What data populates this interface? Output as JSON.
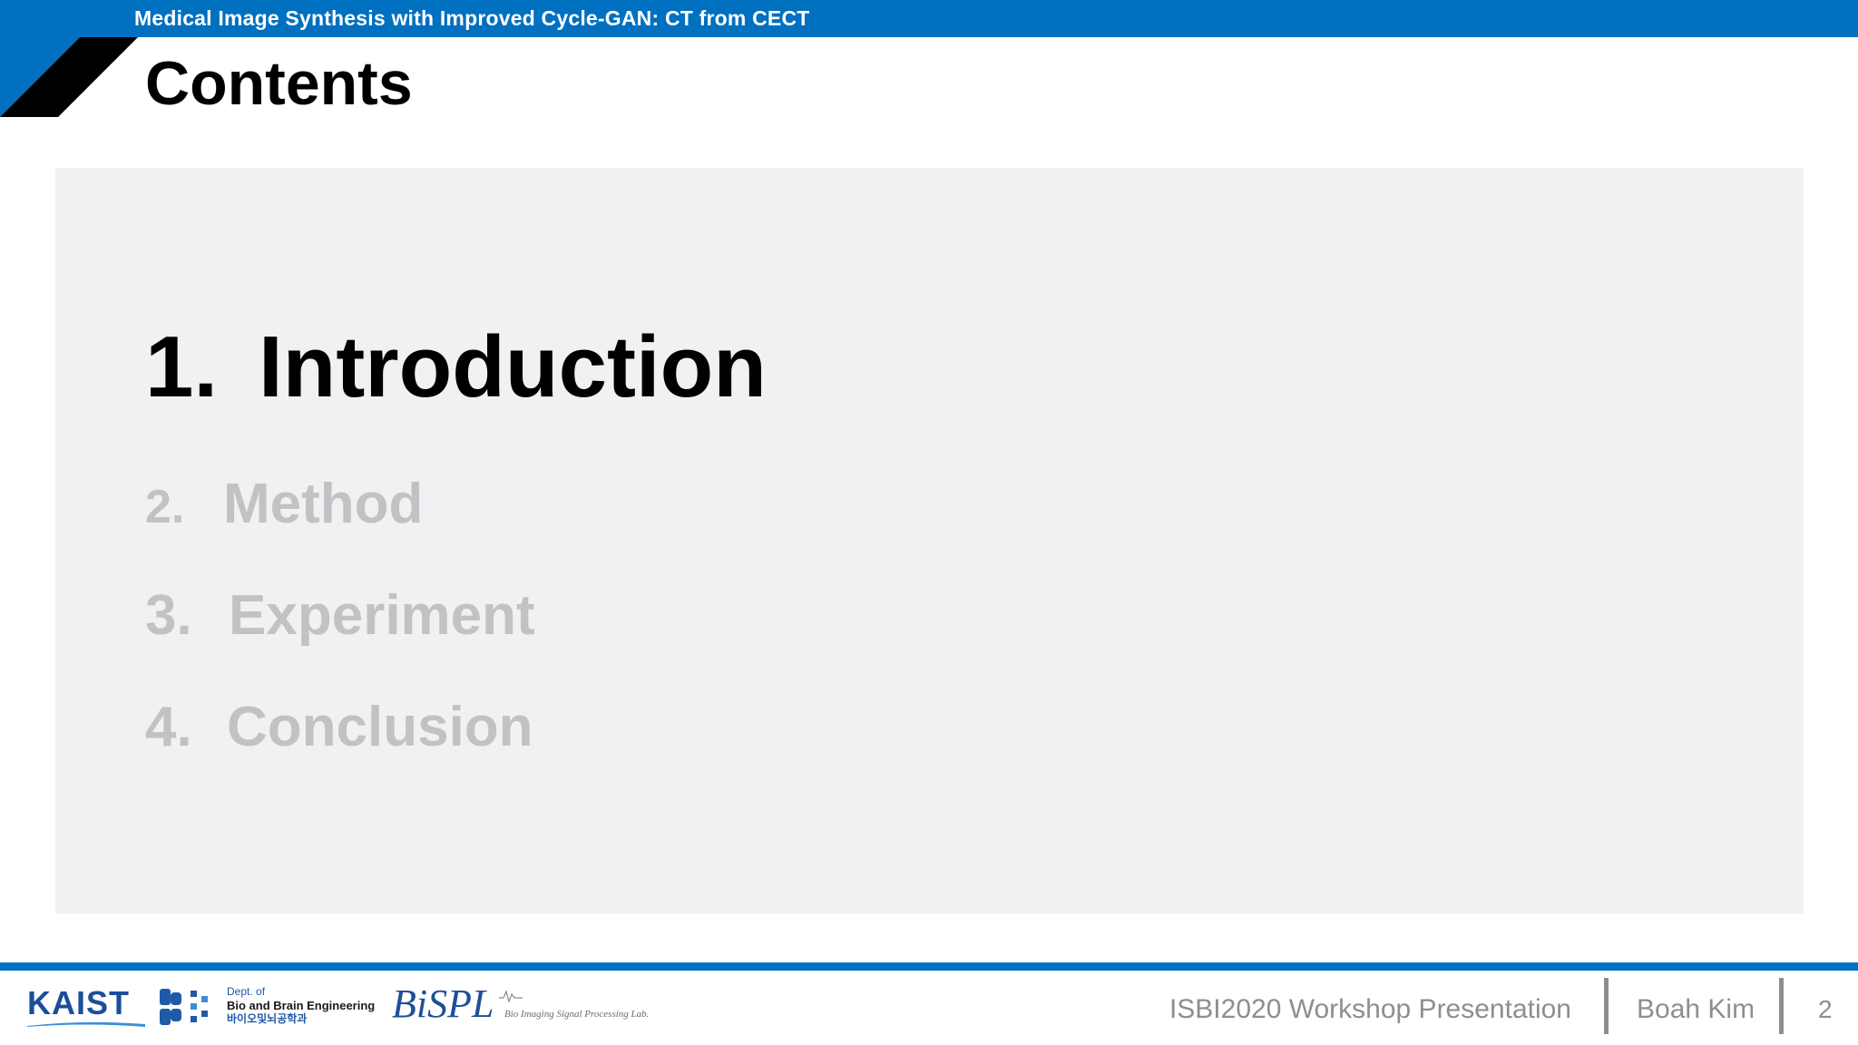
{
  "header": {
    "title": "Medical Image Synthesis with Improved Cycle-GAN: CT from CECT"
  },
  "section_title": "Contents",
  "toc": {
    "items": [
      {
        "number": "1.",
        "label": "Introduction",
        "active": true
      },
      {
        "number": "2.",
        "label": "Method",
        "active": false
      },
      {
        "number": "3.",
        "label": "Experiment",
        "active": false
      },
      {
        "number": "4.",
        "label": "Conclusion",
        "active": false
      }
    ]
  },
  "footer": {
    "logos": {
      "kaist": "KAIST",
      "dept_line1": "Dept. of",
      "dept_line2": "Bio and Brain Engineering",
      "dept_line3": "바이오및뇌공학과",
      "bispl": "BiSPL",
      "bispl_sub": "Bio Imaging Signal Processing Lab."
    },
    "event": "ISBI2020 Workshop Presentation",
    "author": "Boah Kim",
    "page_number": "2"
  },
  "colors": {
    "accent_blue": "#0070c0",
    "panel_background": "#f1f0f2",
    "inactive_text": "#c2c1c4",
    "footer_text": "#8e8e8e"
  }
}
